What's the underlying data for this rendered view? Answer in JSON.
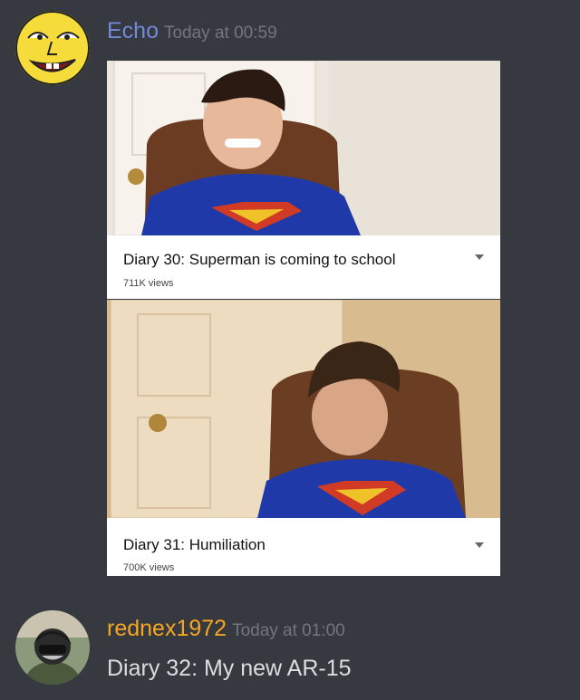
{
  "messages": [
    {
      "username": "Echo",
      "username_color": "#7289da",
      "timestamp": "Today at 00:59",
      "avatar_icon": "yellow-cartoon-face-avatar",
      "embeds": [
        {
          "title": "Diary 30: Superman is coming to school",
          "views": "711K views"
        },
        {
          "title": "Diary 31: Humiliation",
          "views": "700K views"
        }
      ]
    },
    {
      "username": "rednex1972",
      "username_color": "#f5a623",
      "timestamp": "Today at 01:00",
      "avatar_icon": "masked-character-avatar",
      "text": "Diary 32: My new AR-15"
    }
  ],
  "colors": {
    "background": "#36393f",
    "timestamp": "#72767d",
    "message_text": "#dcddde"
  }
}
